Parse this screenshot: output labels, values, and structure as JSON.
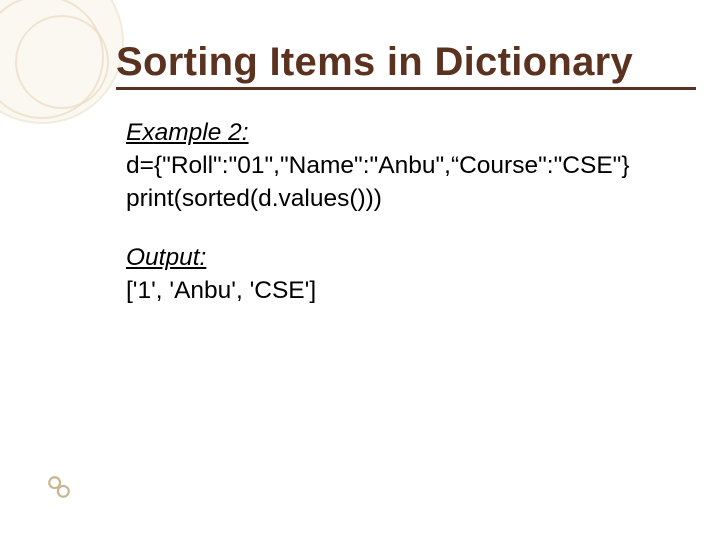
{
  "title": "Sorting Items in Dictionary",
  "example": {
    "label": "Example 2:",
    "lines": [
      "d={\"Roll\":\"01\",\"Name\":\"Anbu\",“Course\":\"CSE\"}",
      "print(sorted(d.values()))"
    ]
  },
  "output": {
    "label": "Output:",
    "text": "['1', 'Anbu', 'CSE']"
  },
  "decor": {
    "corner_icon": "chain-link-icon"
  }
}
